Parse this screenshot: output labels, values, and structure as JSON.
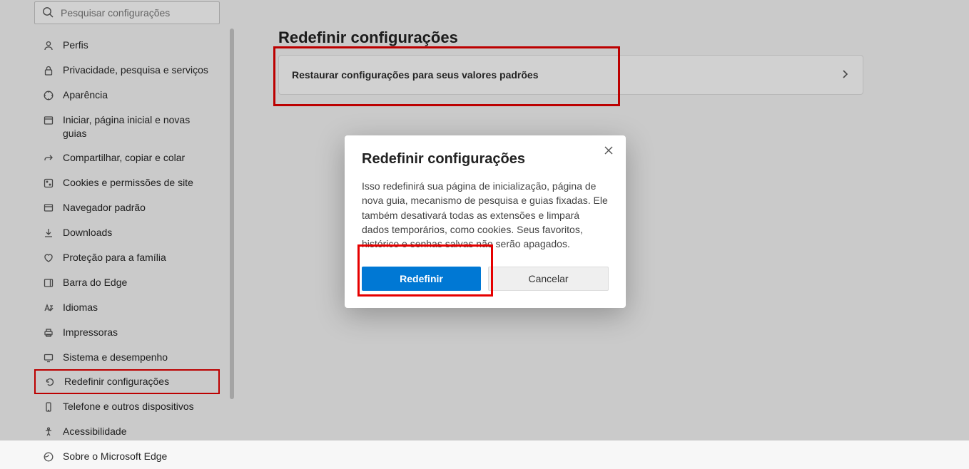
{
  "sidebar": {
    "search_placeholder": "Pesquisar configurações",
    "items": [
      {
        "label": "Perfis"
      },
      {
        "label": "Privacidade, pesquisa e serviços"
      },
      {
        "label": "Aparência"
      },
      {
        "label": "Iniciar, página inicial e novas guias"
      },
      {
        "label": "Compartilhar, copiar e colar"
      },
      {
        "label": "Cookies e permissões de site"
      },
      {
        "label": "Navegador padrão"
      },
      {
        "label": "Downloads"
      },
      {
        "label": "Proteção para a família"
      },
      {
        "label": "Barra do Edge"
      },
      {
        "label": "Idiomas"
      },
      {
        "label": "Impressoras"
      },
      {
        "label": "Sistema e desempenho"
      },
      {
        "label": "Redefinir configurações"
      },
      {
        "label": "Telefone e outros dispositivos"
      },
      {
        "label": "Acessibilidade"
      },
      {
        "label": "Sobre o Microsoft Edge"
      }
    ]
  },
  "main": {
    "title": "Redefinir configurações",
    "row_label": "Restaurar configurações para seus valores padrões"
  },
  "dialog": {
    "title": "Redefinir configurações",
    "body": "Isso redefinirá sua página de inicialização, página de nova guia, mecanismo de pesquisa e guias fixadas. Ele também desativará todas as extensões e limpará dados temporários, como cookies. Seus favoritos, histórico e senhas salvas não serão apagados.",
    "primary": "Redefinir",
    "secondary": "Cancelar"
  }
}
